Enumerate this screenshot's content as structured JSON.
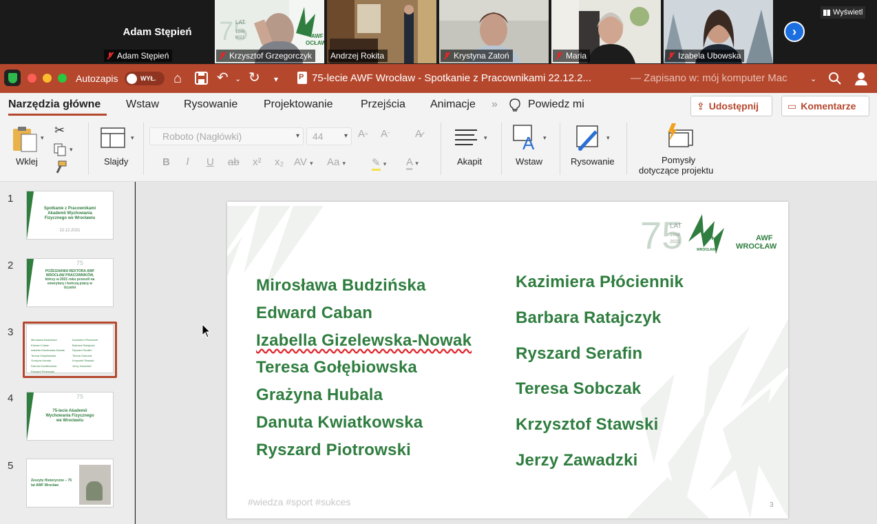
{
  "gallery": {
    "featured_name": "Adam Stępień",
    "participants": [
      {
        "label": "Adam Stępień"
      },
      {
        "label": "Krzysztof Grzegorczyk"
      },
      {
        "label": "Andrzej Rokita"
      },
      {
        "label": "Krystyna Zatoń"
      },
      {
        "label": "Maria"
      },
      {
        "label": "Izabela Ubowska"
      }
    ],
    "view_button": "Wyświetl",
    "logo_overlay": {
      "number": "75",
      "lat": "LAT",
      "years": "1946\n2021",
      "awf": "AWF",
      "wroclaw": "OCŁAW"
    }
  },
  "titlebar": {
    "autosave_label": "Autozapis",
    "toggle_state": "WYŁ.",
    "document_title": "75-lecie AWF Wrocław - Spotkanie z Pracownikami 22.12.2...",
    "saved_location": "— Zapisano w: mój komputer Mac"
  },
  "tabs": {
    "items": [
      "Narzędzia główne",
      "Wstaw",
      "Rysowanie",
      "Projektowanie",
      "Przejścia",
      "Animacje"
    ],
    "more": "»",
    "tell_me": "Powiedz mi",
    "share": "Udostępnij",
    "comments": "Komentarze"
  },
  "ribbon": {
    "paste": "Wklej",
    "slides": "Slajdy",
    "font_name": "Roboto (Nagłówki)",
    "font_size": "44",
    "paragraph": "Akapit",
    "insert": "Wstaw",
    "drawing": "Rysowanie",
    "designer_line1": "Pomysły",
    "designer_line2": "dotyczące projektu",
    "fmt": {
      "bold": "B",
      "italic": "I",
      "underline": "U",
      "strike": "ab",
      "sup": "x²",
      "sub": "x₂",
      "spacing": "AV",
      "case": "Aa",
      "grow": "A^",
      "shrink": "Aˇ"
    }
  },
  "slides": {
    "numbers": [
      "1",
      "2",
      "3",
      "4",
      "5"
    ],
    "thumb1": "Spotkanie z Pracownikami Akademii Wychowania Fizycznego we Wrocławiu",
    "thumb1_sub": "22.12.2021",
    "thumb2": "POŻEGNANIA REKTORA AWF WROCŁAW PRACOWNIKÓW, którzy w 2021 roku przeszli na emeryturę i kończą pracę w Uczelni",
    "thumb4": "75-lecie Akademii Wychowania Fizycznego we Wrocławiu",
    "thumb5": "Zeszyty Historyczne – 75 lat AWF Wrocław"
  },
  "slide": {
    "logo": {
      "number": "75",
      "lat": "LAT",
      "years_top": "1946",
      "years_bottom": "2021",
      "awf": "AWF",
      "wroclaw": "WROCŁAW",
      "small": "WROCŁAW"
    },
    "left_names": [
      "Mirosława Budzińska",
      "Edward Caban",
      "Izabella Gizelewska-Nowak",
      "Teresa Gołębiowska",
      "Grażyna Hubala",
      "Danuta Kwiatkowska",
      "Ryszard Piotrowski"
    ],
    "right_names": [
      "Kazimiera Płóciennik",
      "Barbara Ratajczyk",
      "Ryszard Serafin",
      "Teresa Sobczak",
      "Krzysztof Stawski",
      "Jerzy Zawadzki"
    ],
    "hashtags": "#wiedza  #sport  #sukces",
    "page_number": "3"
  },
  "colors": {
    "accent": "#b5472d",
    "brand_green": "#2f7d3f",
    "zoom_blue": "#1b6fe0"
  }
}
